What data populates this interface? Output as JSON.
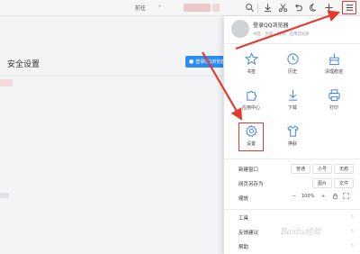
{
  "topbar": {
    "prev_label": "前往",
    "chevron": "›",
    "icons": [
      "download-icon",
      "scissors-icon",
      "undo-icon",
      "night-mode-icon",
      "new-tab-plus-icon",
      "menu-icon"
    ]
  },
  "page": {
    "title": "安全设置",
    "login_button": "登录QQ浏览器"
  },
  "account": {
    "name": "登录QQ浏览器",
    "subtitle": "书签、历史、选项、应用云同步"
  },
  "grid": [
    {
      "label": "书签",
      "icon": "star-icon"
    },
    {
      "label": "历史",
      "icon": "clock-icon"
    },
    {
      "label": "清理痕迹",
      "icon": "broom-icon"
    },
    {
      "label": "应用中心",
      "icon": "puzzle-icon"
    },
    {
      "label": "下载",
      "icon": "download-icon"
    },
    {
      "label": "打印",
      "icon": "printer-icon"
    },
    {
      "label": "设置",
      "icon": "gear-icon"
    },
    {
      "label": "换肤",
      "icon": "tshirt-icon"
    }
  ],
  "rows": {
    "new_window": {
      "label": "新建窗口",
      "options": [
        "普通",
        "小号",
        "无痕"
      ]
    },
    "save_as": {
      "label": "网页另存为",
      "options": [
        "图片",
        "文件"
      ]
    },
    "zoom": {
      "label": "缩放",
      "minus": "−",
      "value": "100%",
      "plus": "+"
    },
    "tools": {
      "label": "工具",
      "arrow": "›"
    },
    "feedback": {
      "label": "反馈建议",
      "arrow": "›"
    },
    "help": {
      "label": "帮助",
      "arrow": "›"
    }
  },
  "watermark": "Baidu经验",
  "colors": {
    "highlight": "#e23a2e",
    "accent": "#2d8cf0",
    "icon_blue": "#3a7fe0"
  }
}
